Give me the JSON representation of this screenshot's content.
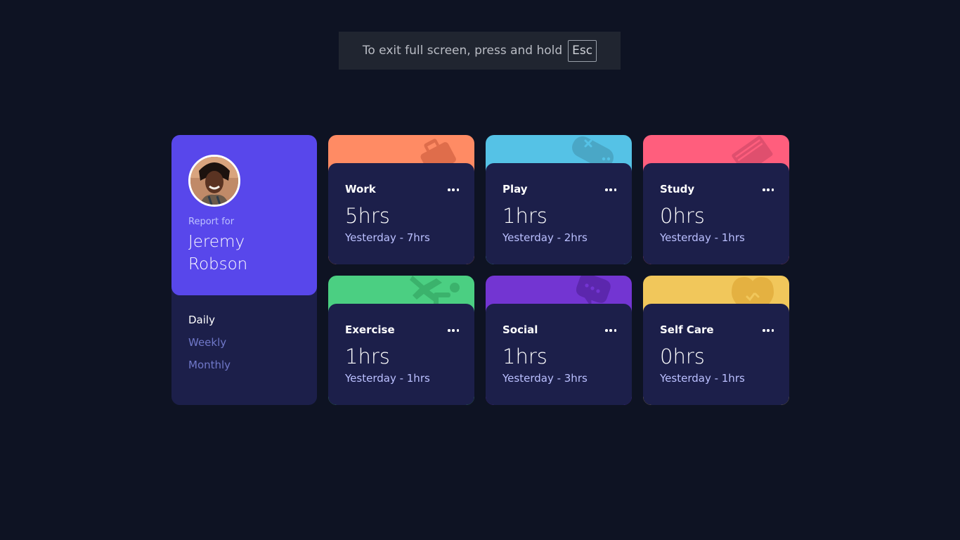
{
  "fullscreen_notice": {
    "text": "To exit full screen, press and hold",
    "key": "Esc"
  },
  "profile": {
    "report_label": "Report for",
    "name": "Jeremy Robson",
    "avatar_alt": "Jeremy Robson avatar"
  },
  "periods": [
    {
      "label": "Daily",
      "active": true
    },
    {
      "label": "Weekly",
      "active": false
    },
    {
      "label": "Monthly",
      "active": false
    }
  ],
  "activities": [
    {
      "title": "Work",
      "current": "5hrs",
      "previous": "Yesterday - 7hrs",
      "color": "#ff8b64",
      "icon": "work-briefcase-icon"
    },
    {
      "title": "Play",
      "current": "1hrs",
      "previous": "Yesterday - 2hrs",
      "color": "#55c2e6",
      "icon": "play-gamepad-icon"
    },
    {
      "title": "Study",
      "current": "0hrs",
      "previous": "Yesterday - 1hrs",
      "color": "#ff5e7d",
      "icon": "study-book-icon"
    },
    {
      "title": "Exercise",
      "current": "1hrs",
      "previous": "Yesterday - 1hrs",
      "color": "#4bcf82",
      "icon": "exercise-runner-icon"
    },
    {
      "title": "Social",
      "current": "1hrs",
      "previous": "Yesterday - 3hrs",
      "color": "#7335d2",
      "icon": "social-chat-icon"
    },
    {
      "title": "Self Care",
      "current": "0hrs",
      "previous": "Yesterday - 1hrs",
      "color": "#f1c75b",
      "icon": "selfcare-heart-icon"
    }
  ]
}
